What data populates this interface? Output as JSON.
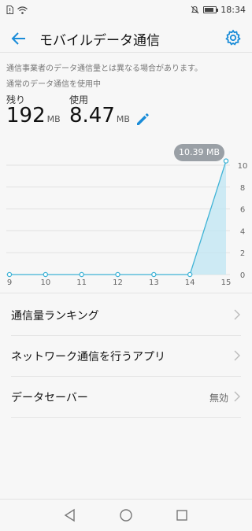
{
  "status_bar": {
    "time": "18:34"
  },
  "app_bar": {
    "title": "モバイルデータ通信"
  },
  "notes": {
    "disclaimer": "通信事業者のデータ通信量とは異なる場合があります。",
    "mode": "通常のデータ通信を使用中"
  },
  "stats": {
    "remaining_label": "残り",
    "remaining_value": "192",
    "remaining_unit": "MB",
    "used_label": "使用",
    "used_value": "8.47",
    "used_unit": "MB"
  },
  "chart_data": {
    "type": "area",
    "x": [
      9,
      10,
      11,
      12,
      13,
      14,
      15
    ],
    "values": [
      0,
      0,
      0,
      0,
      0,
      0,
      10.39
    ],
    "xticks": [
      "9",
      "10",
      "11",
      "12",
      "13",
      "14",
      "15"
    ],
    "yticks": [
      "10",
      "8",
      "6",
      "4",
      "2",
      "0"
    ],
    "ylim": [
      0,
      10
    ],
    "grid": true,
    "tooltip": "10.39 MB",
    "color": "#3fb3d6"
  },
  "menu": [
    {
      "label": "通信量ランキング",
      "value": ""
    },
    {
      "label": "ネットワーク通信を行うアプリ",
      "value": ""
    },
    {
      "label": "データセーバー",
      "value": "無効"
    }
  ],
  "colors": {
    "accent": "#1a8cd8",
    "chart": "#3fb3d6"
  },
  "icons": [
    "back-arrow-icon",
    "settings-gear-icon",
    "edit-pencil-icon",
    "chevron-right-icon",
    "nav-back-icon",
    "nav-home-icon",
    "nav-recents-icon"
  ]
}
